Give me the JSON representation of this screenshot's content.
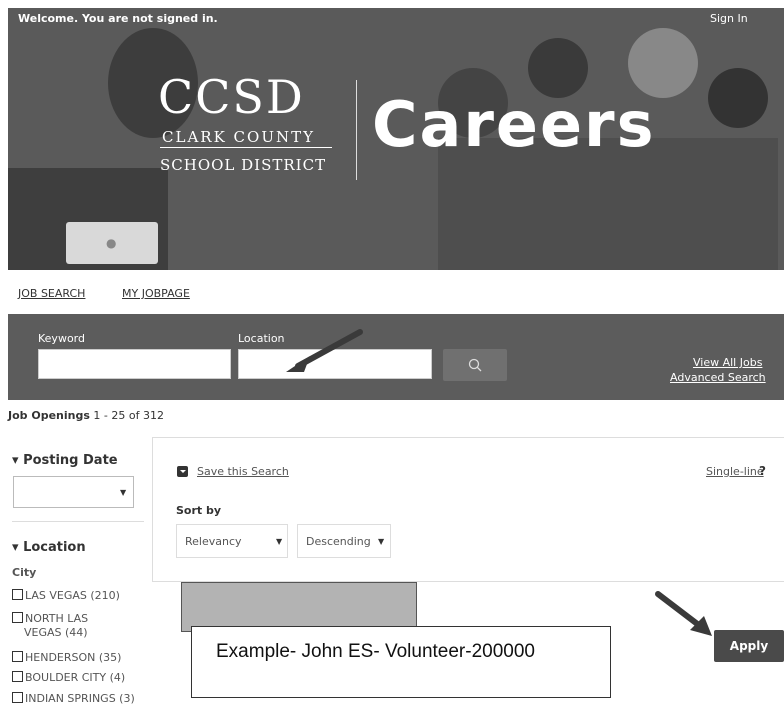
{
  "header": {
    "welcome_text": "Welcome. You are not signed in.",
    "signin_label": "Sign In",
    "logo": {
      "abbr": "CCSD",
      "line1": "CLARK COUNTY",
      "line2": "SCHOOL DISTRICT"
    },
    "banner_title": "Careers"
  },
  "nav": {
    "items": [
      {
        "label": "JOB SEARCH"
      },
      {
        "label": "MY JOBPAGE"
      }
    ]
  },
  "search": {
    "keyword_label": "Keyword",
    "keyword_value": "",
    "location_label": "Location",
    "location_value": "",
    "search_button_icon": "search-icon",
    "view_all_jobs": "View All Jobs",
    "advanced_search": "Advanced Search"
  },
  "results": {
    "openings_label": "Job Openings",
    "openings_range": "1 - 25 of 312"
  },
  "filters": {
    "posting_date": {
      "title": "Posting Date",
      "value": ""
    },
    "location": {
      "title": "Location",
      "city_label": "City",
      "cities": [
        {
          "label": "LAS VEGAS (210)"
        },
        {
          "label": "NORTH LAS"
        },
        {
          "label": "VEGAS (44)"
        },
        {
          "label": "HENDERSON (35)"
        },
        {
          "label": "BOULDER CITY (4)"
        },
        {
          "label": "INDIAN SPRINGS (3)"
        }
      ]
    }
  },
  "toolbar": {
    "save_search": "Save this Search",
    "single_line": "Single-line",
    "help_icon_text": "?",
    "sort_by_label": "Sort by",
    "sort_field": "Relevancy",
    "sort_order": "Descending"
  },
  "annotation": {
    "example_text": "Example- John ES- Volunteer-200000"
  },
  "apply_label": "Apply",
  "colors": {
    "search_bar_bg": "#5c5c5c",
    "apply_bg": "#4a4a4a"
  }
}
